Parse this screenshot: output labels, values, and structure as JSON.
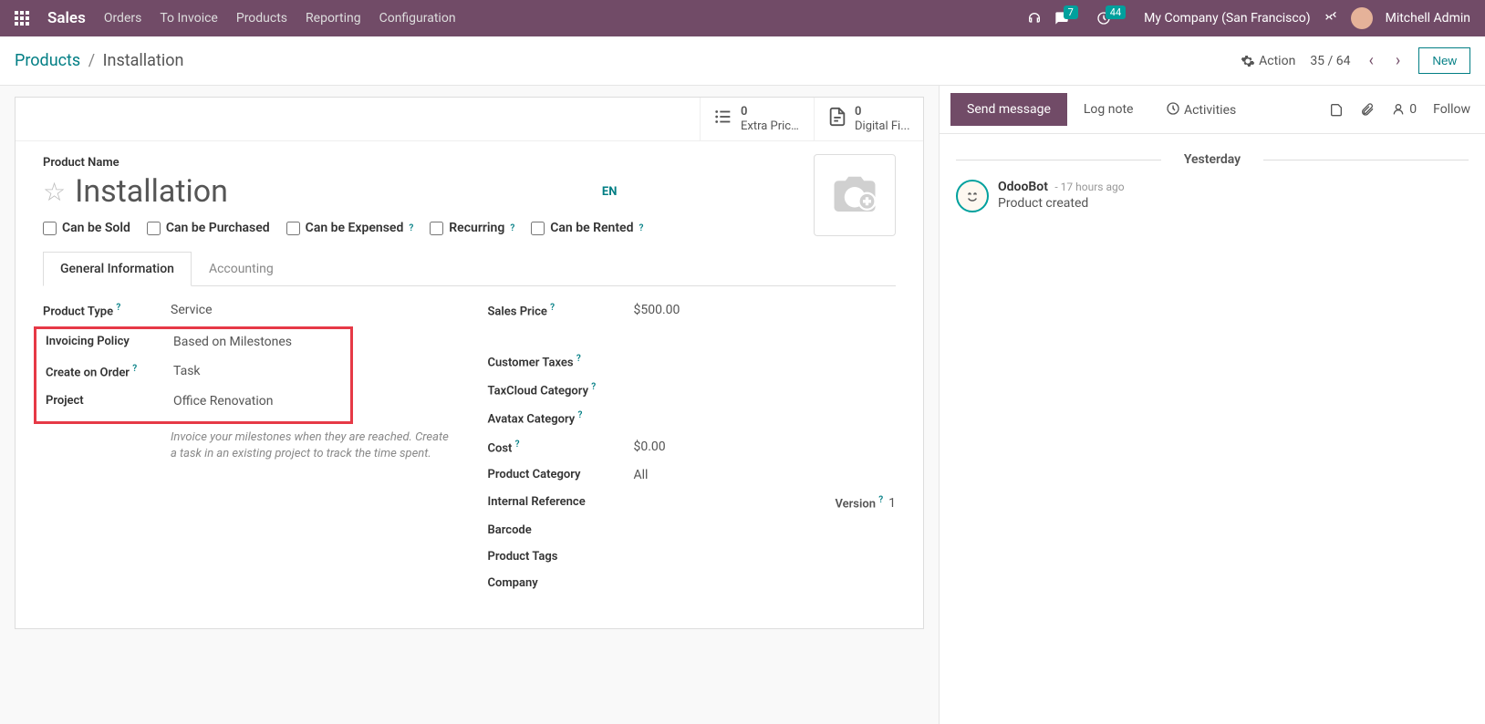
{
  "navbar": {
    "brand": "Sales",
    "menu": [
      "Orders",
      "To Invoice",
      "Products",
      "Reporting",
      "Configuration"
    ],
    "messages_badge": "7",
    "activities_badge": "44",
    "company": "My Company (San Francisco)",
    "user": "Mitchell Admin"
  },
  "breadcrumb": {
    "parent": "Products",
    "current": "Installation"
  },
  "controls": {
    "action": "Action",
    "pager": "35 / 64",
    "new": "New"
  },
  "stat_buttons": {
    "extra_prices": {
      "count": "0",
      "label": "Extra Prices"
    },
    "digital_files": {
      "count": "0",
      "label": "Digital Fi..."
    }
  },
  "product": {
    "name_label": "Product Name",
    "name": "Installation",
    "lang": "EN"
  },
  "checkboxes": {
    "can_be_sold": "Can be Sold",
    "can_be_purchased": "Can be Purchased",
    "can_be_expensed": "Can be Expensed",
    "recurring": "Recurring",
    "can_be_rented": "Can be Rented"
  },
  "tabs": {
    "general": "General Information",
    "accounting": "Accounting"
  },
  "fields_left": {
    "product_type": {
      "label": "Product Type",
      "value": "Service"
    },
    "invoicing_policy": {
      "label": "Invoicing Policy",
      "value": "Based on Milestones"
    },
    "create_on_order": {
      "label": "Create on Order",
      "value": "Task"
    },
    "project": {
      "label": "Project",
      "value": "Office Renovation"
    },
    "hint": "Invoice your milestones when they are reached. Create a task in an existing project to track the time spent."
  },
  "fields_right": {
    "sales_price": {
      "label": "Sales Price",
      "value": "$500.00"
    },
    "customer_taxes": {
      "label": "Customer Taxes",
      "value": ""
    },
    "taxcloud_category": {
      "label": "TaxCloud Category",
      "value": ""
    },
    "avatax_category": {
      "label": "Avatax Category",
      "value": ""
    },
    "cost": {
      "label": "Cost",
      "value": "$0.00"
    },
    "product_category": {
      "label": "Product Category",
      "value": "All"
    },
    "internal_reference": {
      "label": "Internal Reference",
      "value": ""
    },
    "version": {
      "label": "Version",
      "value": "1"
    },
    "barcode": {
      "label": "Barcode",
      "value": ""
    },
    "product_tags": {
      "label": "Product Tags",
      "value": ""
    },
    "company": {
      "label": "Company",
      "value": ""
    }
  },
  "chatter": {
    "send_message": "Send message",
    "log_note": "Log note",
    "activities": "Activities",
    "followers": "0",
    "follow": "Follow",
    "separator": "Yesterday",
    "message": {
      "author": "OdooBot",
      "time": "- 17 hours ago",
      "body": "Product created"
    }
  }
}
